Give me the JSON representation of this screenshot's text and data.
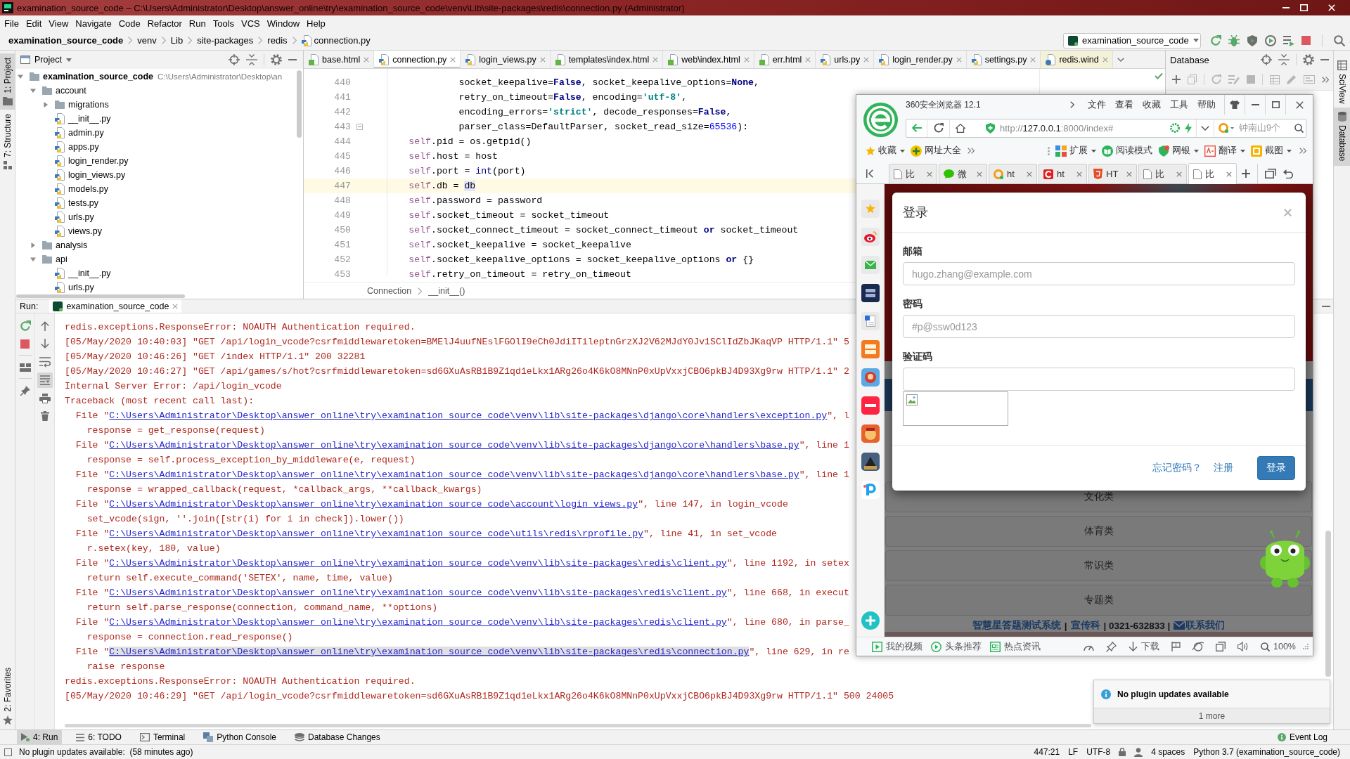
{
  "window": {
    "title": "examination_source_code – C:\\Users\\Administrator\\Desktop\\answer_online\\try\\examination_source_code\\venv\\Lib\\site-packages\\redis\\connection.py (Administrator)"
  },
  "menu": [
    "File",
    "Edit",
    "View",
    "Navigate",
    "Code",
    "Refactor",
    "Run",
    "Tools",
    "VCS",
    "Window",
    "Help"
  ],
  "navbar": {
    "breadcrumb": [
      {
        "label": "examination_source_code",
        "kind": "project"
      },
      {
        "label": "venv",
        "kind": "folder"
      },
      {
        "label": "Lib",
        "kind": "folder"
      },
      {
        "label": "site-packages",
        "kind": "folder"
      },
      {
        "label": "redis",
        "kind": "folder"
      },
      {
        "label": "connection.py",
        "kind": "python"
      }
    ],
    "run_config": "examination_source_code"
  },
  "left_strip": {
    "top": [
      {
        "label": "1: Project",
        "kind": "project",
        "selected": true
      },
      {
        "label": "7: Structure",
        "kind": "structure",
        "selected": false
      }
    ],
    "bottom": [
      {
        "label": "2: Favorites",
        "kind": "favorites",
        "selected": false
      }
    ]
  },
  "right_strip": {
    "top": [
      {
        "label": "SciView",
        "kind": "sciview",
        "selected": false
      },
      {
        "label": "Database",
        "kind": "database",
        "selected": true
      }
    ]
  },
  "project": {
    "title": "Project",
    "tree": [
      {
        "label": "examination_source_code",
        "note": "C:\\Users\\Administrator\\Desktop\\an",
        "kind": "root",
        "expanded": true,
        "children": [
          {
            "label": "account",
            "kind": "folder",
            "expanded": true,
            "children": [
              {
                "label": "migrations",
                "kind": "folder",
                "expanded": false
              },
              {
                "label": "__init__.py",
                "kind": "python"
              },
              {
                "label": "admin.py",
                "kind": "python"
              },
              {
                "label": "apps.py",
                "kind": "python"
              },
              {
                "label": "login_render.py",
                "kind": "python"
              },
              {
                "label": "login_views.py",
                "kind": "python"
              },
              {
                "label": "models.py",
                "kind": "python"
              },
              {
                "label": "tests.py",
                "kind": "python"
              },
              {
                "label": "urls.py",
                "kind": "python"
              },
              {
                "label": "views.py",
                "kind": "python"
              }
            ]
          },
          {
            "label": "analysis",
            "kind": "folder",
            "expanded": false
          },
          {
            "label": "api",
            "kind": "folder",
            "expanded": true,
            "children": [
              {
                "label": "__init__.py",
                "kind": "python"
              },
              {
                "label": "urls.py",
                "kind": "python"
              }
            ]
          }
        ]
      }
    ]
  },
  "editor": {
    "tabs": [
      {
        "label": "base.html",
        "kind": "html",
        "selected": false
      },
      {
        "label": "connection.py",
        "kind": "python",
        "selected": true
      },
      {
        "label": "login_views.py",
        "kind": "python",
        "selected": false
      },
      {
        "label": "templates\\index.html",
        "kind": "html",
        "selected": false
      },
      {
        "label": "web\\index.html",
        "kind": "html",
        "selected": false
      },
      {
        "label": "err.html",
        "kind": "html",
        "selected": false
      },
      {
        "label": "urls.py",
        "kind": "python",
        "selected": false
      },
      {
        "label": "login_render.py",
        "kind": "python",
        "selected": false
      },
      {
        "label": "settings.py",
        "kind": "python",
        "selected": false
      },
      {
        "label": "redis.wind",
        "kind": "config",
        "selected": false
      }
    ],
    "lines": [
      {
        "number": "440",
        "current": false,
        "fold": false,
        "segments": [
          {
            "kind": "plain",
            "text": "                 socket_keepalive="
          },
          {
            "kind": "keyword",
            "text": "False"
          },
          {
            "kind": "plain",
            "text": ", socket_keepalive_options="
          },
          {
            "kind": "keyword",
            "text": "None"
          },
          {
            "kind": "plain",
            "text": ","
          }
        ]
      },
      {
        "number": "441",
        "current": false,
        "fold": false,
        "segments": [
          {
            "kind": "plain",
            "text": "                 retry_on_timeout="
          },
          {
            "kind": "keyword",
            "text": "False"
          },
          {
            "kind": "plain",
            "text": ", encoding="
          },
          {
            "kind": "string",
            "text": "'utf-8'"
          },
          {
            "kind": "plain",
            "text": ","
          }
        ]
      },
      {
        "number": "442",
        "current": false,
        "fold": false,
        "segments": [
          {
            "kind": "plain",
            "text": "                 encoding_errors="
          },
          {
            "kind": "string",
            "text": "'strict'"
          },
          {
            "kind": "plain",
            "text": ", decode_responses="
          },
          {
            "kind": "keyword",
            "text": "False"
          },
          {
            "kind": "plain",
            "text": ","
          }
        ]
      },
      {
        "number": "443",
        "current": false,
        "fold": true,
        "segments": [
          {
            "kind": "plain",
            "text": "                 parser_class=DefaultParser, socket_read_size="
          },
          {
            "kind": "number",
            "text": "65536"
          },
          {
            "kind": "plain",
            "text": "):"
          }
        ]
      },
      {
        "number": "444",
        "current": false,
        "fold": false,
        "segments": [
          {
            "kind": "self",
            "text": "        self"
          },
          {
            "kind": "plain",
            "text": ".pid = os.getpid()"
          }
        ]
      },
      {
        "number": "445",
        "current": false,
        "fold": false,
        "segments": [
          {
            "kind": "self",
            "text": "        self"
          },
          {
            "kind": "plain",
            "text": ".host = host"
          }
        ]
      },
      {
        "number": "446",
        "current": false,
        "fold": false,
        "segments": [
          {
            "kind": "self",
            "text": "        self"
          },
          {
            "kind": "plain",
            "text": ".port = "
          },
          {
            "kind": "builtin",
            "text": "int"
          },
          {
            "kind": "plain",
            "text": "(port)"
          }
        ]
      },
      {
        "number": "447",
        "current": true,
        "fold": false,
        "segments": [
          {
            "kind": "self",
            "text": "        self"
          },
          {
            "kind": "plain",
            "text": ".db = "
          },
          {
            "kind": "usage",
            "text": "db"
          }
        ]
      },
      {
        "number": "448",
        "current": false,
        "fold": false,
        "segments": [
          {
            "kind": "self",
            "text": "        self"
          },
          {
            "kind": "plain",
            "text": ".password = password"
          }
        ]
      },
      {
        "number": "449",
        "current": false,
        "fold": false,
        "segments": [
          {
            "kind": "self",
            "text": "        self"
          },
          {
            "kind": "plain",
            "text": ".socket_timeout = socket_timeout"
          }
        ]
      },
      {
        "number": "450",
        "current": false,
        "fold": false,
        "segments": [
          {
            "kind": "self",
            "text": "        self"
          },
          {
            "kind": "plain",
            "text": ".socket_connect_timeout = socket_connect_timeout "
          },
          {
            "kind": "keyword",
            "text": "or"
          },
          {
            "kind": "plain",
            "text": " socket_timeout"
          }
        ]
      },
      {
        "number": "451",
        "current": false,
        "fold": false,
        "segments": [
          {
            "kind": "self",
            "text": "        self"
          },
          {
            "kind": "plain",
            "text": ".socket_keepalive = socket_keepalive"
          }
        ]
      },
      {
        "number": "452",
        "current": false,
        "fold": false,
        "segments": [
          {
            "kind": "self",
            "text": "        self"
          },
          {
            "kind": "plain",
            "text": ".socket_keepalive_options = socket_keepalive_options "
          },
          {
            "kind": "keyword",
            "text": "or"
          },
          {
            "kind": "plain",
            "text": " {}"
          }
        ]
      },
      {
        "number": "453",
        "current": false,
        "fold": false,
        "segments": [
          {
            "kind": "self",
            "text": "        self"
          },
          {
            "kind": "plain",
            "text": ".retry_on_timeout = retry_on_timeout"
          }
        ]
      }
    ],
    "breadcrumb": [
      "Connection",
      "__init__()"
    ]
  },
  "database": {
    "title": "Database"
  },
  "run": {
    "title": "Run:",
    "tab": "examination_source_code",
    "toggles": {
      "soft_wrap": false,
      "scroll_to_end": true
    },
    "lines": [
      {
        "kind": "text",
        "text": "redis.exceptions.ResponseError: NOAUTH Authentication required."
      },
      {
        "kind": "text",
        "text": "[05/May/2020 10:40:03] \"GET /api/login_vcode?csrfmiddlewaretoken=BMElJ4uufNEslFGOlI9eCh0JdiITileptnGrzXJ2V62MJdY0Jv1SClIdZbJKaqVP HTTP/1.1\" 5"
      },
      {
        "kind": "text",
        "text": "[05/May/2020 10:46:26] \"GET /index HTTP/1.1\" 200 32281"
      },
      {
        "kind": "text",
        "text": "[05/May/2020 10:46:27] \"GET /api/games/s/hot?csrfmiddlewaretoken=sd6GXuAsRB1B9Z1qd1eLkx1ARg26o4K6kO8MNnP0xUpVxxjCBO6pkBJ4D93Xg9rw HTTP/1.1\" 2"
      },
      {
        "kind": "text",
        "text": "Internal Server Error: /api/login_vcode"
      },
      {
        "kind": "text",
        "text": "Traceback (most recent call last):"
      },
      {
        "kind": "file",
        "before": "  File \"",
        "link": "C:\\Users\\Administrator\\Desktop\\answer_online\\try\\examination_source_code\\venv\\lib\\site-packages\\django\\core\\handlers\\exception.py",
        "after": "\", l",
        "highlighted": false
      },
      {
        "kind": "text",
        "text": "    response = get_response(request)"
      },
      {
        "kind": "file",
        "before": "  File \"",
        "link": "C:\\Users\\Administrator\\Desktop\\answer_online\\try\\examination_source_code\\venv\\lib\\site-packages\\django\\core\\handlers\\base.py",
        "after": "\", line 1",
        "highlighted": false
      },
      {
        "kind": "text",
        "text": "    response = self.process_exception_by_middleware(e, request)"
      },
      {
        "kind": "file",
        "before": "  File \"",
        "link": "C:\\Users\\Administrator\\Desktop\\answer_online\\try\\examination_source_code\\venv\\lib\\site-packages\\django\\core\\handlers\\base.py",
        "after": "\", line 1",
        "highlighted": false
      },
      {
        "kind": "text",
        "text": "    response = wrapped_callback(request, *callback_args, **callback_kwargs)"
      },
      {
        "kind": "file",
        "before": "  File \"",
        "link": "C:\\Users\\Administrator\\Desktop\\answer_online\\try\\examination_source_code\\account\\login_views.py",
        "after": "\", line 147, in login_vcode",
        "highlighted": false
      },
      {
        "kind": "text",
        "text": "    set_vcode(sign, ''.join([str(i) for i in check]).lower())"
      },
      {
        "kind": "file",
        "before": "  File \"",
        "link": "C:\\Users\\Administrator\\Desktop\\answer_online\\try\\examination_source_code\\utils\\redis\\rprofile.py",
        "after": "\", line 41, in set_vcode",
        "highlighted": false
      },
      {
        "kind": "text",
        "text": "    r.setex(key, 180, value)"
      },
      {
        "kind": "file",
        "before": "  File \"",
        "link": "C:\\Users\\Administrator\\Desktop\\answer_online\\try\\examination_source_code\\venv\\lib\\site-packages\\redis\\client.py",
        "after": "\", line 1192, in setex",
        "highlighted": false
      },
      {
        "kind": "text",
        "text": "    return self.execute_command('SETEX', name, time, value)"
      },
      {
        "kind": "file",
        "before": "  File \"",
        "link": "C:\\Users\\Administrator\\Desktop\\answer_online\\try\\examination_source_code\\venv\\lib\\site-packages\\redis\\client.py",
        "after": "\", line 668, in execut",
        "highlighted": false
      },
      {
        "kind": "text",
        "text": "    return self.parse_response(connection, command_name, **options)"
      },
      {
        "kind": "file",
        "before": "  File \"",
        "link": "C:\\Users\\Administrator\\Desktop\\answer_online\\try\\examination_source_code\\venv\\lib\\site-packages\\redis\\client.py",
        "after": "\", line 680, in parse_",
        "highlighted": false
      },
      {
        "kind": "text",
        "text": "    response = connection.read_response()"
      },
      {
        "kind": "file",
        "before": "  File \"",
        "link": "C:\\Users\\Administrator\\Desktop\\answer_online\\try\\examination_source_code\\venv\\lib\\site-packages\\redis\\connection.py",
        "after": "\", line 629, in re",
        "highlighted": true
      },
      {
        "kind": "text",
        "text": "    raise response"
      },
      {
        "kind": "text",
        "text": "redis.exceptions.ResponseError: NOAUTH Authentication required."
      },
      {
        "kind": "text",
        "text": "[05/May/2020 10:46:29] \"GET /api/login_vcode?csrfmiddlewaretoken=sd6GXuAsRB1B9Z1qd1eLkx1ARg26o4K6kO8MNnP0xUpVxxjCBO6pkBJ4D93Xg9rw HTTP/1.1\" 500 24005"
      }
    ]
  },
  "browser": {
    "title": "360安全浏览器 12.1",
    "menu": [
      "文件",
      "查看",
      "收藏",
      "工具",
      "帮助"
    ],
    "address": {
      "url": [
        {
          "kind": "dim",
          "text": "http://"
        },
        {
          "kind": "host",
          "text": "127.0.0.1"
        },
        {
          "kind": "dim",
          "text": ":8000/index#"
        }
      ],
      "search_placeholder": "钟南山9个"
    },
    "bookmarks": [
      {
        "label": "收藏",
        "kind": "star",
        "dropdown": true
      },
      {
        "label": "网址大全",
        "kind": "globe",
        "dropdown": false
      }
    ],
    "tools": [
      {
        "label": "扩展",
        "kind": "extension",
        "dropdown": true
      },
      {
        "label": "阅读模式",
        "kind": "reader",
        "dropdown": false
      },
      {
        "label": "网银",
        "kind": "bank",
        "dropdown": true
      },
      {
        "label": "翻译",
        "kind": "translate",
        "dropdown": true
      },
      {
        "label": "截图",
        "kind": "screenshot",
        "dropdown": true
      }
    ],
    "tabs": [
      {
        "label": "比",
        "kind": "page",
        "selected": false
      },
      {
        "label": "微",
        "kind": "chat",
        "selected": false
      },
      {
        "label": "ht",
        "kind": "ring",
        "selected": false
      },
      {
        "label": "ht",
        "kind": "tile",
        "selected": false
      },
      {
        "label": "HT",
        "kind": "shield",
        "selected": false
      },
      {
        "label": "比",
        "kind": "page",
        "selected": false
      },
      {
        "label": "比",
        "kind": "page",
        "selected": true
      }
    ],
    "page": {
      "categories": [
        "文化类",
        "体育类",
        "常识类",
        "专题类"
      ],
      "footer": [
        {
          "kind": "link",
          "text": "智慧星答题测试系统"
        },
        {
          "kind": "text",
          "text": "|"
        },
        {
          "kind": "link",
          "text": "宣传科"
        },
        {
          "kind": "text",
          "text": "| 0321-632833 |"
        },
        {
          "kind": "mail",
          "text": "联系我们"
        }
      ]
    },
    "dialog": {
      "title": "登录",
      "fields": [
        {
          "label": "邮箱",
          "placeholder": "hugo.zhang@example.com",
          "captcha": false
        },
        {
          "label": "密码",
          "placeholder": "#p@ssw0d123",
          "captcha": false
        },
        {
          "label": "验证码",
          "captcha": true
        }
      ],
      "links": [
        "忘记密码？",
        "注册"
      ],
      "submit": "登录"
    },
    "status_left": [
      {
        "kind": "video",
        "label": "我的视频"
      },
      {
        "kind": "play",
        "label": "头条推荐"
      },
      {
        "kind": "news",
        "label": "热点资讯"
      }
    ],
    "status_right": [
      {
        "kind": "speed"
      },
      {
        "kind": "pin"
      },
      {
        "kind": "download",
        "label": "下载"
      },
      {
        "kind": "flag"
      },
      {
        "kind": "orbit"
      },
      {
        "kind": "window"
      },
      {
        "kind": "sound"
      },
      {
        "kind": "zoom",
        "label": "100%"
      }
    ]
  },
  "notification": {
    "title": "No plugin updates available",
    "more": "1 more"
  },
  "tool_windows": [
    {
      "label": "4: Run",
      "kind": "run",
      "selected": true
    },
    {
      "label": "6: TODO",
      "kind": "todo",
      "selected": false
    },
    {
      "label": "Terminal",
      "kind": "terminal",
      "selected": false
    },
    {
      "label": "Python Console",
      "kind": "console",
      "selected": false
    },
    {
      "label": "Database Changes",
      "kind": "changes",
      "selected": false
    }
  ],
  "event_log": "Event Log",
  "status_bar": {
    "message": "No plugin updates available:  (58 minutes ago)",
    "items": [
      {
        "kind": "text",
        "text": "447:21"
      },
      {
        "kind": "text",
        "text": "LF"
      },
      {
        "kind": "text",
        "text": "UTF-8"
      },
      {
        "kind": "lock"
      },
      {
        "kind": "inspector"
      },
      {
        "kind": "text",
        "text": "4 spaces"
      },
      {
        "kind": "text",
        "text": "Python 3.7 (examination_source_code)"
      }
    ]
  }
}
